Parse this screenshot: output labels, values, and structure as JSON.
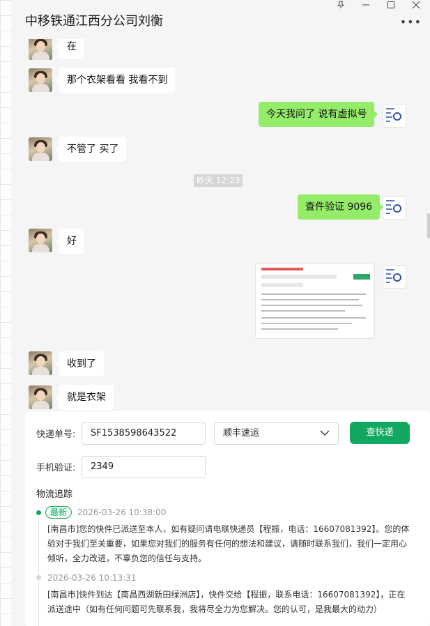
{
  "window": {
    "title": "中移铁通江西分公司刘衡",
    "pin_icon": "pin-icon",
    "minimize_icon": "minimize-icon",
    "maximize_icon": "maximize-icon",
    "close_icon": "close-icon",
    "more_icon": "more-icon"
  },
  "chat": {
    "messages": [
      {
        "side": "in",
        "text": "在"
      },
      {
        "side": "in",
        "text": "那个衣架看看 我看不到"
      },
      {
        "side": "out",
        "text": "今天我问了  说有虚拟号"
      },
      {
        "side": "in",
        "text": "不管了  买了"
      },
      {
        "side": "out",
        "text": "查件验证 9096"
      },
      {
        "side": "in",
        "text": "好"
      },
      {
        "side": "out",
        "text": ""
      },
      {
        "side": "in",
        "text": "收到了"
      },
      {
        "side": "in",
        "text": "就是衣架"
      }
    ],
    "timestamp": "昨天 12:23"
  },
  "tracking": {
    "waybill_label": "快递单号:",
    "waybill_value": "SF1538598643522",
    "carrier_value": "顺丰速运",
    "query_label": "查快递",
    "phone_label": "手机验证:",
    "phone_value": "2349",
    "section_title": "物流追踪",
    "events": [
      {
        "badge": "最新",
        "time": "2026-03-26 10:38:00",
        "text": "[南昌市]您的快件已派送至本人，如有疑问请电联快递员【程振，电话：16607081392】。您的体验对于我们至关重要，如果您对我们的服务有任何的想法和建议，请随时联系我们，我们一定用心倾听，全力改进，不辜负您的信任与支持。"
      },
      {
        "badge": "",
        "time": "2026-03-26 10:13:31",
        "text": "[南昌市]快件到达【南昌西湖新田绿洲店】，快件交给【程振，联系电话：16607081392】，正在派送途中（如有任何问题可先联系我，我将尽全力为您解决。您的认可，是我最大的动力）"
      }
    ]
  },
  "colors": {
    "accent": "#13a861",
    "bubble_out": "#95ec69",
    "bubble_in": "#ffffff"
  }
}
